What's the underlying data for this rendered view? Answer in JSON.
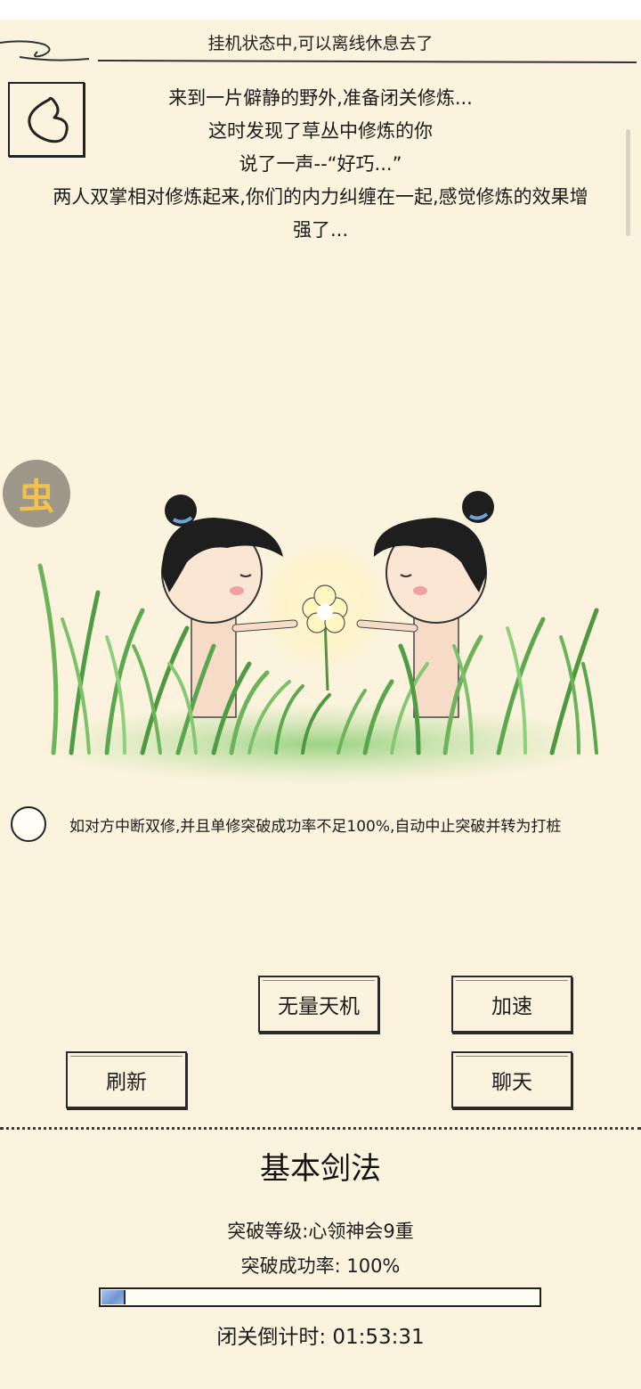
{
  "status_text": "挂机状态中,可以离线休息去了",
  "story_lines": [
    "来到一片僻静的野外,准备闭关修炼...",
    "这时发现了草丛中修炼的你",
    "说了一声--“好巧...”",
    "两人双掌相对修炼起来,你们的内力纠缠在一起,感觉修炼的效果增",
    "强了..."
  ],
  "float_button_glyph": "虫",
  "option_text": "如对方中断双修,并且单修突破成功率不足100%,自动中止突破并转为打桩",
  "buttons": {
    "wuliang": "无量天机",
    "speed": "加速",
    "refresh": "刷新",
    "chat": "聊天"
  },
  "skill": {
    "name": "基本剑法",
    "level_line": "突破等级:心领神会9重",
    "rate_line": "突破成功率: 100%",
    "progress_fraction": 0.05,
    "countdown_line": "闭关倒计时: 01:53:31"
  },
  "icons": {
    "back": "back-arrow-icon",
    "float": "bug-icon"
  },
  "colors": {
    "background": "#fbf3dd",
    "progress_fill": "#7a9fd6",
    "float_button": "#9d978a",
    "float_glyph": "#f2c34c"
  }
}
